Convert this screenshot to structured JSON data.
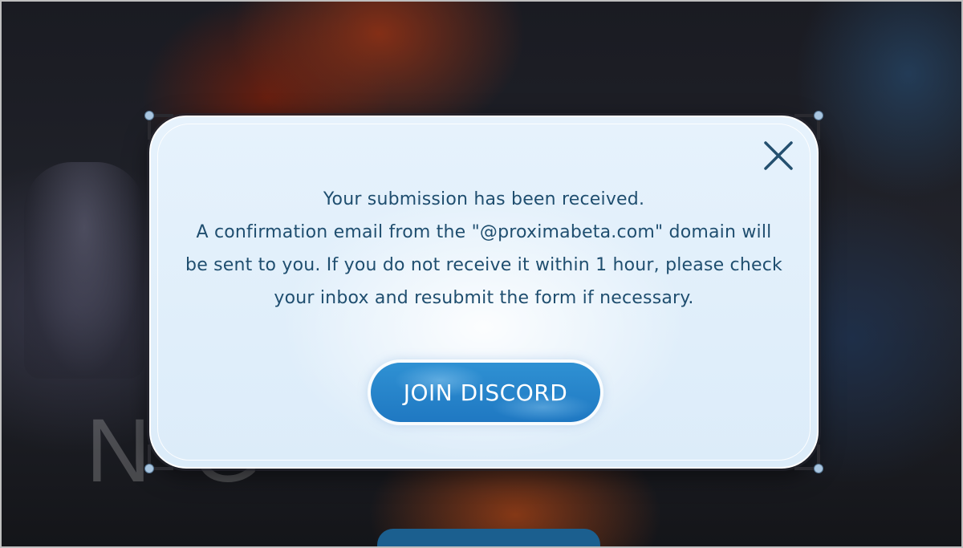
{
  "background": {
    "title_fragment": "N   G"
  },
  "dialog": {
    "message_lines": [
      "Your submission has been received.",
      "A confirmation email from the \"@proximabeta.com\" domain will",
      "be sent to you. If you do not receive it within 1 hour, please check",
      "your inbox and resubmit the form if necessary."
    ],
    "button_label": "JOIN DISCORD",
    "close_icon": "close-icon"
  },
  "colors": {
    "text": "#1f4e6f",
    "button": "#2a87cc",
    "dialog_bg": "#e2effa"
  }
}
